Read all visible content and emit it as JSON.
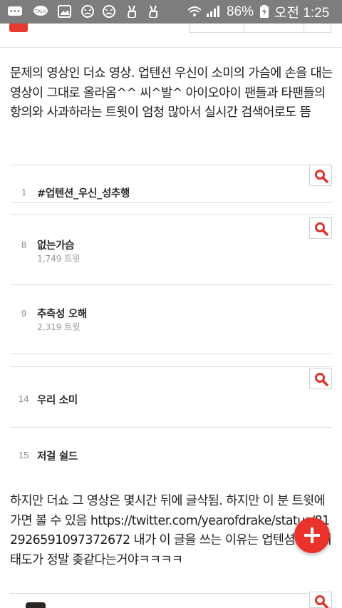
{
  "status_bar": {
    "battery": "86%",
    "time": "오전 1:25",
    "icons": [
      "message-icon",
      "talk-icon",
      "gallery-icon",
      "face-icon",
      "face-icon",
      "victory-icon",
      "victory-icon",
      "wifi-icon",
      "signal-icon",
      "battery-charging-icon"
    ]
  },
  "post": {
    "paragraph1": "문제의 영상인 더쇼 영상. 업텐션 우신이 소미의 가슴에 손을 대는 영상이 그대로 올라옴^^ 씨^발^ 아이오아이 팬들과 타팬들의 항의와 사과하라는 트윗이 엄청 많아서 실시간 검색어로도 뜸",
    "trends": [
      {
        "rank": "1",
        "topic": "#업텐션_우신_성추행",
        "tweets": ""
      },
      {
        "rank": "8",
        "topic": "없는가슴",
        "tweets": "1,749 트윗"
      },
      {
        "rank": "9",
        "topic": "추측성 오해",
        "tweets": "2,319 트윗"
      },
      {
        "rank": "14",
        "topic": "우리 소미",
        "tweets": ""
      },
      {
        "rank": "15",
        "topic": "저걸 쉴드",
        "tweets": ""
      }
    ],
    "paragraph2": "하지만 더쇼 그 영상은 몇시간 뒤에 글삭됨. 하지만 이 분 트윗에 가면 볼 수 있음 https://twitter.com/yearofdrake/status/812926591097372672 내가 이 글을 쓰는 이유는 업텐셤 팬들의 태도가 정말 좆같다는거야ㅋㅋㅋㅋ"
  },
  "colors": {
    "accent": "#e8322b",
    "status_bar": "#7d7d7d",
    "search_icon": "#e0322c"
  },
  "fab": {
    "icon": "plus-icon"
  }
}
